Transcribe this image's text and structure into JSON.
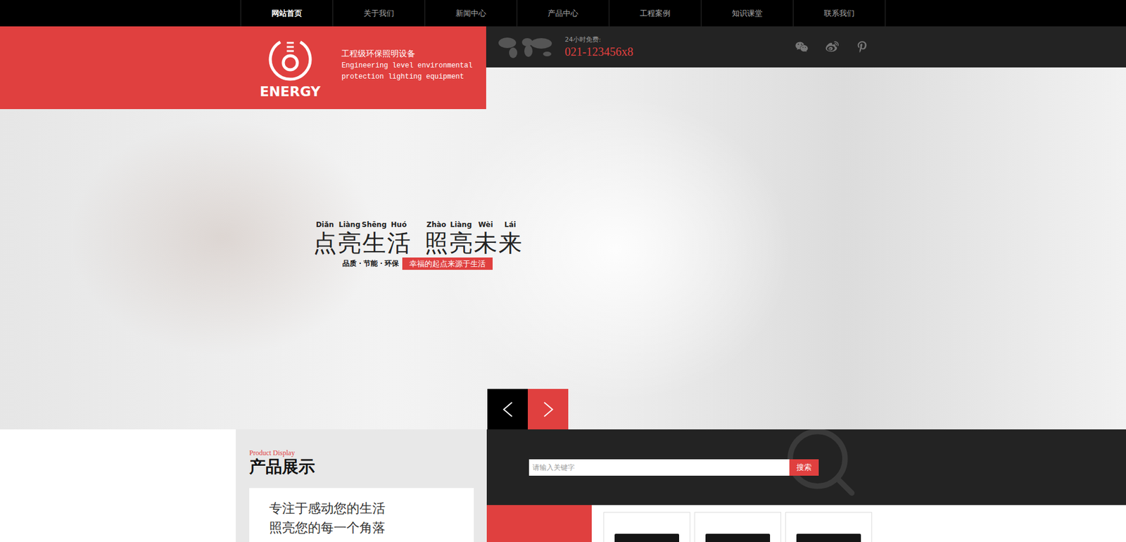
{
  "nav": [
    {
      "label": "网站首页",
      "selected": true
    },
    {
      "label": "关于我们",
      "selected": false
    },
    {
      "label": "新闻中心",
      "selected": false
    },
    {
      "label": "产品中心",
      "selected": false
    },
    {
      "label": "工程案例",
      "selected": false
    },
    {
      "label": "知识课堂",
      "selected": false
    },
    {
      "label": "联系我们",
      "selected": false
    }
  ],
  "brand": {
    "logo": "ENERGY",
    "tagline": "工程级环保照明设备",
    "tagline_en": [
      "Engineering level environmental",
      "protection lighting equipment"
    ]
  },
  "hotline": {
    "label": "24小时免费:",
    "number": "021-123456x8"
  },
  "hero": {
    "slogan": [
      {
        "chars": "点亮生活",
        "pinyin": [
          "Diǎn",
          "Liàng",
          "Shēng",
          "Huó"
        ]
      },
      {
        "chars": "照亮未来",
        "pinyin": [
          "Zhào",
          "Liàng",
          "Wèi",
          "Lái"
        ]
      }
    ],
    "features": "品质・节能・环保",
    "badge": "幸福的起点来源于生活"
  },
  "products": {
    "label_en": "Product Display",
    "title": "产品展示",
    "intro": [
      "专注于感动您的生活",
      "照亮您的每一个角落"
    ],
    "cards": [
      {},
      {},
      {}
    ]
  },
  "search": {
    "placeholder": "请输入关键字",
    "button": "搜索"
  }
}
